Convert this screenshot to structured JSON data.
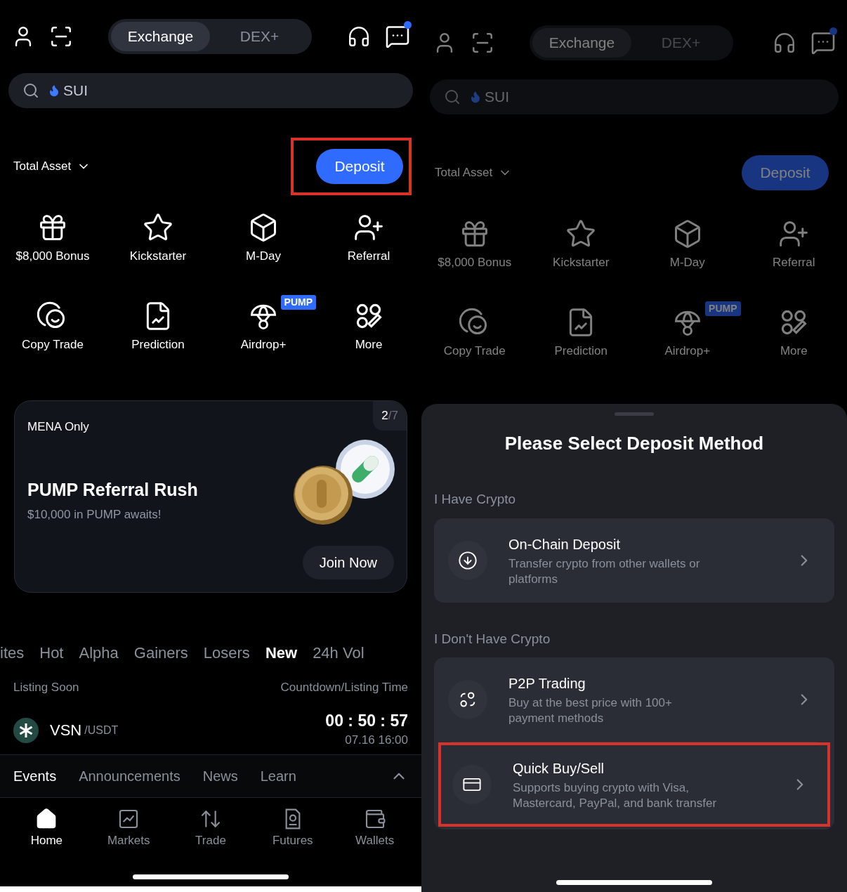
{
  "left_screen": {
    "top": {
      "header": {
        "segments": [
          {
            "label": "Exchange",
            "selected": true
          },
          {
            "label": "DEX+",
            "selected": false
          }
        ],
        "messages_unread": true
      },
      "search": {
        "placeholder": "SUI"
      },
      "total_asset": {
        "label": "Total Asset"
      },
      "deposit_button": {
        "label": "Deposit",
        "highlighted": true
      },
      "shortcuts": [
        {
          "label": "$8,000 Bonus"
        },
        {
          "label": "Kickstarter"
        },
        {
          "label": "M-Day"
        },
        {
          "label": "Referral"
        },
        {
          "label": "Copy Trade"
        },
        {
          "label": "Prediction"
        },
        {
          "label": "Airdrop+",
          "badge": "PUMP"
        },
        {
          "label": "More"
        }
      ]
    },
    "banner": {
      "tag": "MENA Only",
      "page_current": "2",
      "page_total": "/7",
      "title": "PUMP Referral Rush",
      "subtitle": "$10,000 in PUMP awaits!",
      "button": "Join Now"
    },
    "market_tabs": [
      {
        "label": "ites",
        "selected": false
      },
      {
        "label": "Hot",
        "selected": false
      },
      {
        "label": "Alpha",
        "selected": false
      },
      {
        "label": "Gainers",
        "selected": false
      },
      {
        "label": "Losers",
        "selected": false
      },
      {
        "label": "New",
        "selected": true
      },
      {
        "label": "24h Vol",
        "selected": false
      }
    ],
    "listing": {
      "headers": [
        "Listing Soon",
        "Countdown/Listing Time"
      ],
      "rows": [
        {
          "base": "VSN",
          "quote": "/USDT",
          "countdown": "00 : 50 : 57",
          "listing_time": "07.16 16:00"
        }
      ]
    },
    "content_tabs": [
      {
        "label": "Events",
        "selected": true
      },
      {
        "label": "Announcements",
        "selected": false
      },
      {
        "label": "News",
        "selected": false
      },
      {
        "label": "Learn",
        "selected": false
      }
    ],
    "bottom_nav": [
      {
        "label": "Home",
        "selected": true
      },
      {
        "label": "Markets",
        "selected": false
      },
      {
        "label": "Trade",
        "selected": false
      },
      {
        "label": "Futures",
        "selected": false
      },
      {
        "label": "Wallets",
        "selected": false
      }
    ]
  },
  "right_screen": {
    "top": {
      "header": {
        "segments": [
          {
            "label": "Exchange",
            "selected": true
          },
          {
            "label": "DEX+",
            "selected": false
          }
        ],
        "messages_unread": true
      },
      "search": {
        "placeholder": "SUI"
      },
      "total_asset": {
        "label": "Total Asset"
      },
      "deposit_button": {
        "label": "Deposit"
      },
      "shortcuts": [
        {
          "label": "$8,000 Bonus"
        },
        {
          "label": "Kickstarter"
        },
        {
          "label": "M-Day"
        },
        {
          "label": "Referral"
        },
        {
          "label": "Copy Trade"
        },
        {
          "label": "Prediction"
        },
        {
          "label": "Airdrop+",
          "badge": "PUMP"
        },
        {
          "label": "More"
        }
      ]
    },
    "sheet": {
      "title": "Please Select Deposit Method",
      "sections": [
        {
          "heading": "I Have Crypto",
          "options": [
            {
              "title": "On-Chain Deposit",
              "description": "Transfer crypto from other wallets or platforms",
              "highlighted": false
            }
          ]
        },
        {
          "heading": "I Don't Have Crypto",
          "options": [
            {
              "title": "P2P Trading",
              "description": "Buy at the best price with 100+ payment methods",
              "highlighted": false
            },
            {
              "title": "Quick Buy/Sell",
              "description": "Supports buying crypto with Visa, Mastercard, PayPal, and bank transfer",
              "highlighted": true
            }
          ]
        }
      ]
    }
  }
}
